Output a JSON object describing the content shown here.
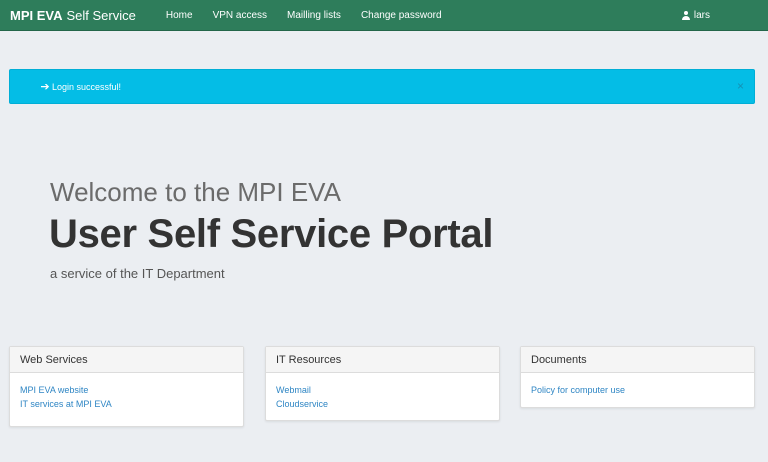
{
  "navbar": {
    "brand_bold": "MPI EVA",
    "brand_rest": "Self Service",
    "links": [
      "Home",
      "VPN access",
      "Mailling lists",
      "Change password"
    ],
    "user": "lars",
    "color": "#2e7d5b"
  },
  "alert": {
    "icon": "arrow-right-icon",
    "message": "Login successful!",
    "close": "×",
    "color": "#04bde6"
  },
  "hero": {
    "welcome": "Welcome to the MPI EVA",
    "title": "User Self Service Portal",
    "subtitle": "a service of the IT Department"
  },
  "panels": [
    {
      "heading": "Web Services",
      "links": [
        "MPI EVA website",
        "IT services at MPI EVA"
      ]
    },
    {
      "heading": "IT Resources",
      "links": [
        "Webmail",
        "Cloudservice"
      ]
    },
    {
      "heading": "Documents",
      "links": [
        "Policy for computer use"
      ]
    }
  ]
}
